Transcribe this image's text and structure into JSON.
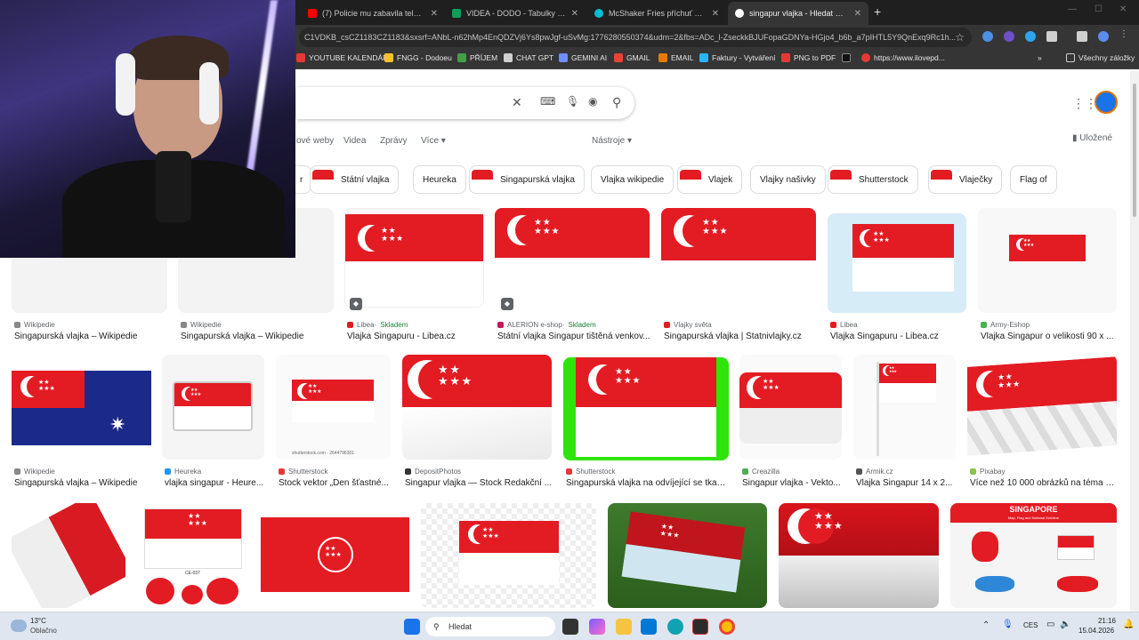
{
  "browser": {
    "tabs": [
      {
        "title": "(7) Policie mu zabavila teleforn",
        "icon": "youtube-icon",
        "color": "#ff0000"
      },
      {
        "title": "VIDEA - DODO - Tabulky Google",
        "icon": "sheets-icon",
        "color": "#0f9d58"
      },
      {
        "title": "McShaker Fries příchuť sýra a b",
        "icon": "site-icon",
        "color": "#00bcd4"
      },
      {
        "title": "singapur vlajka - Hledat Google",
        "icon": "google-icon",
        "color": "#ffffff",
        "active": true
      }
    ],
    "url": "C1VDKB_csCZ1183CZ1183&sxsrf=ANbL-n62hMp4EnQDZVj6Ys8pwJgf-uSvMg:1776280550374&udm=2&fbs=ADc_l-ZseckkBJUFopaGDNYa-HGjo4_b6b_a7pIHTL5Y9QnExq9Rc1h...",
    "bookmarks": [
      "YOUTUBE KALENDÁŘ",
      "FNGG - Dodoeu",
      "PŘÍJEM",
      "CHAT GPT",
      "GEMINI AI",
      "GMAIL",
      "EMAIL",
      "Faktury - Vytváření",
      "PNG to PDF",
      "",
      "https://www.ilovepd..."
    ],
    "all_bookmarks": "Všechny záložky"
  },
  "search": {
    "nav_tabs": [
      "ové weby",
      "Videa",
      "Zprávy",
      "Více"
    ],
    "tools": "Nástroje",
    "saved": "Uložené",
    "chips": [
      "r",
      "Státní vlajka",
      "Heureka",
      "Singapurská vlajka",
      "Vlajka wikipedie",
      "Vlajek",
      "Vlajky našivky",
      "Shutterstock",
      "Vlaječky",
      "Flag of"
    ],
    "row1": [
      {
        "source": "Wikipedie",
        "title": "Singapurská vlajka – Wikipedie",
        "stock": ""
      },
      {
        "source": "Wikipedie",
        "title": "Singapurská vlajka – Wikipedie",
        "stock": ""
      },
      {
        "source": "Libea",
        "title": "Vlajka Singapuru - Libea.cz",
        "stock": "Skladem"
      },
      {
        "source": "ALERION e-shop",
        "title": "Státní vlajka Singapur tištěná venkov...",
        "stock": "Skladem"
      },
      {
        "source": "Vlajky světa",
        "title": "Singapurská vlajka | Statnivlajky.cz",
        "stock": ""
      },
      {
        "source": "Libea",
        "title": "Vlajka Singapuru - Libea.cz",
        "stock": ""
      },
      {
        "source": "Army-Eshop",
        "title": "Vlajka Singapur o velikosti 90 x ...",
        "stock": ""
      }
    ],
    "row2": [
      {
        "source": "Wikipedie",
        "title": "Singapurská vlajka – Wikipedie"
      },
      {
        "source": "Heureka",
        "title": "vlajka singapur - Heure..."
      },
      {
        "source": "Shutterstock",
        "title": "Stock vektor „Den šťastné..."
      },
      {
        "source": "DepositPhotos",
        "title": "Singapur vlajka — Stock Redakční ..."
      },
      {
        "source": "Shutterstock",
        "title": "Singapurská vlajka na odvíjející se tkan..."
      },
      {
        "source": "Creazilla",
        "title": "Singapur vlajka - Vekto..."
      },
      {
        "source": "Armik.cz",
        "title": "Vlajka Singapur 14 x 2..."
      },
      {
        "source": "Pixabay",
        "title": "Více než 10 000 obrázků na téma S..."
      }
    ],
    "shutter_watermark": "shutterstock.com · 2644796301",
    "infographic_title": "SINGAPORE",
    "infographic_sub": "Map, Flag and National Emblem",
    "patch_code": "CE-037"
  },
  "taskbar": {
    "weather_temp": "13°C",
    "weather_desc": "Oblačno",
    "search": "Hledat",
    "lang": "CES",
    "time": "21:16",
    "date": "15.04.2026"
  },
  "colors": {
    "flag_red": "#e31b23",
    "link": "#1a0dab",
    "stock_green": "#188038"
  }
}
